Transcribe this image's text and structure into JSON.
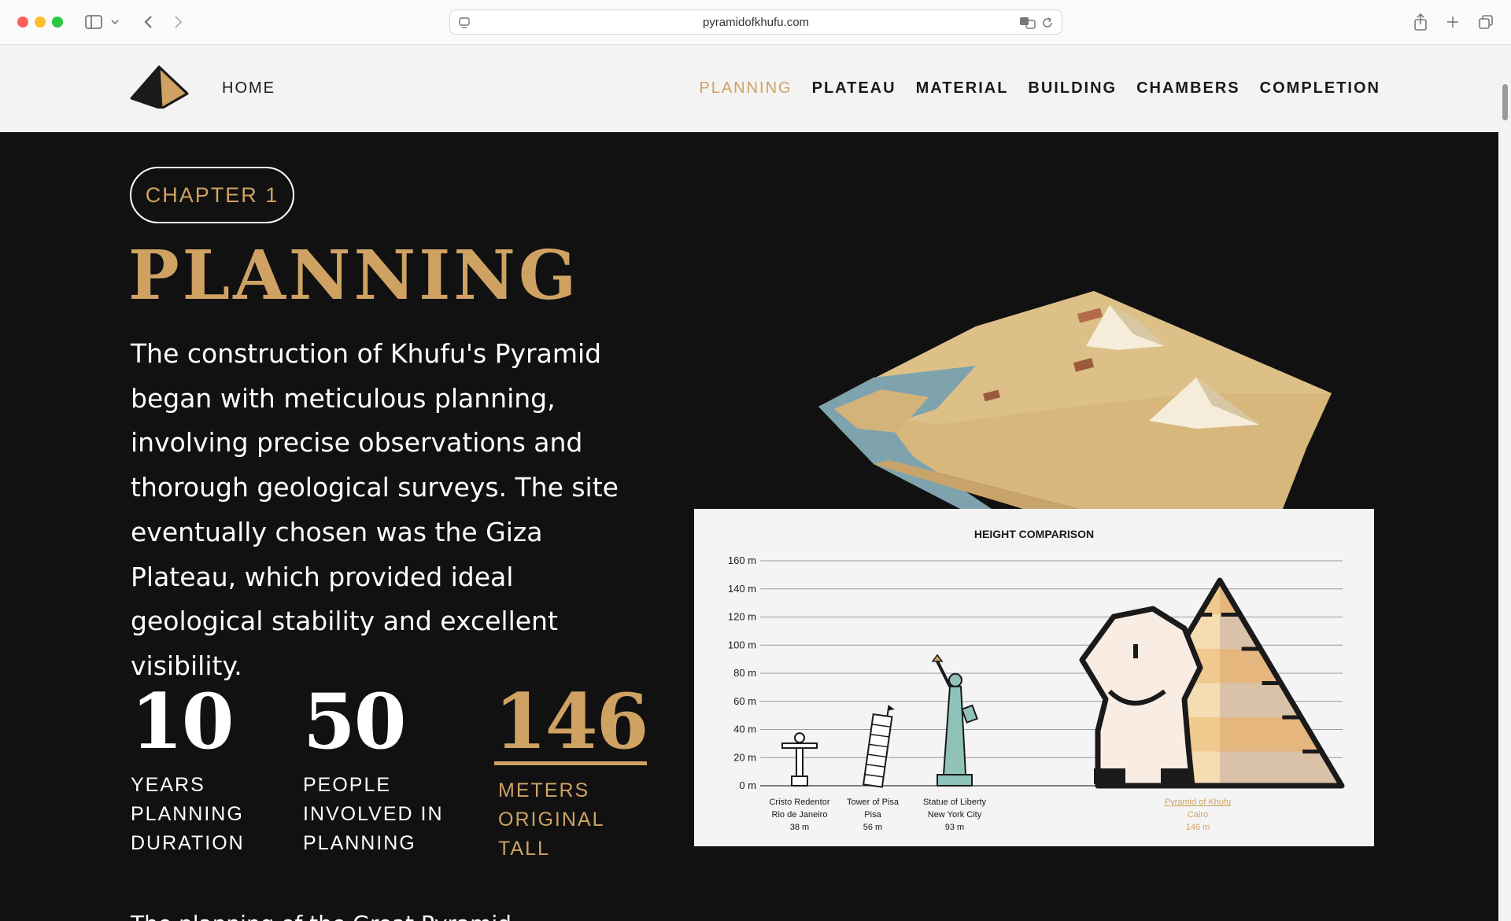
{
  "browser": {
    "url": "pyramidofkhufu.com"
  },
  "header": {
    "home_label": "HOME",
    "nav": [
      {
        "label": "PLANNING",
        "active": true
      },
      {
        "label": "PLATEAU"
      },
      {
        "label": "MATERIAL"
      },
      {
        "label": "BUILDING"
      },
      {
        "label": "CHAMBERS"
      },
      {
        "label": "COMPLETION"
      }
    ]
  },
  "hero": {
    "chapter": "CHAPTER 1",
    "title": "PLANNING",
    "intro": "The construction of Khufu's Pyramid began with meticulous planning, involving precise observations and thorough geological surveys. The site eventually chosen was the Giza Plateau, which provided ideal geological stability and excellent visibility."
  },
  "stats": [
    {
      "value": "10",
      "label": "YEARS PLANNING DURATION"
    },
    {
      "value": "50",
      "label": "PEOPLE INVOLVED IN PLANNING"
    },
    {
      "value": "146",
      "label": "METERS ORIGINAL TALL",
      "highlight": true
    }
  ],
  "bottom_text": "The planning of the Great Pyramid...",
  "colors": {
    "accent": "#cfa263",
    "background": "#111111",
    "header_bg": "#f3f3f3"
  },
  "chart_data": {
    "type": "bar",
    "title": "HEIGHT COMPARISON",
    "ylim": [
      0,
      160
    ],
    "yticks": [
      "0 m",
      "20 m",
      "40 m",
      "60 m",
      "80 m",
      "100 m",
      "120 m",
      "140 m",
      "160 m"
    ],
    "categories": [
      {
        "name": "Cristo Redentor",
        "place": "Rio de Janeiro",
        "height": "38 m"
      },
      {
        "name": "Tower of Pisa",
        "place": "Pisa",
        "height": "56 m"
      },
      {
        "name": "Statue of Liberty",
        "place": "New York City",
        "height": "93 m"
      },
      {
        "name": "Pyramid of Khufu",
        "place": "Cairo",
        "height": "146 m",
        "highlight": true
      }
    ],
    "values": [
      38,
      56,
      93,
      146
    ],
    "grid": true
  }
}
